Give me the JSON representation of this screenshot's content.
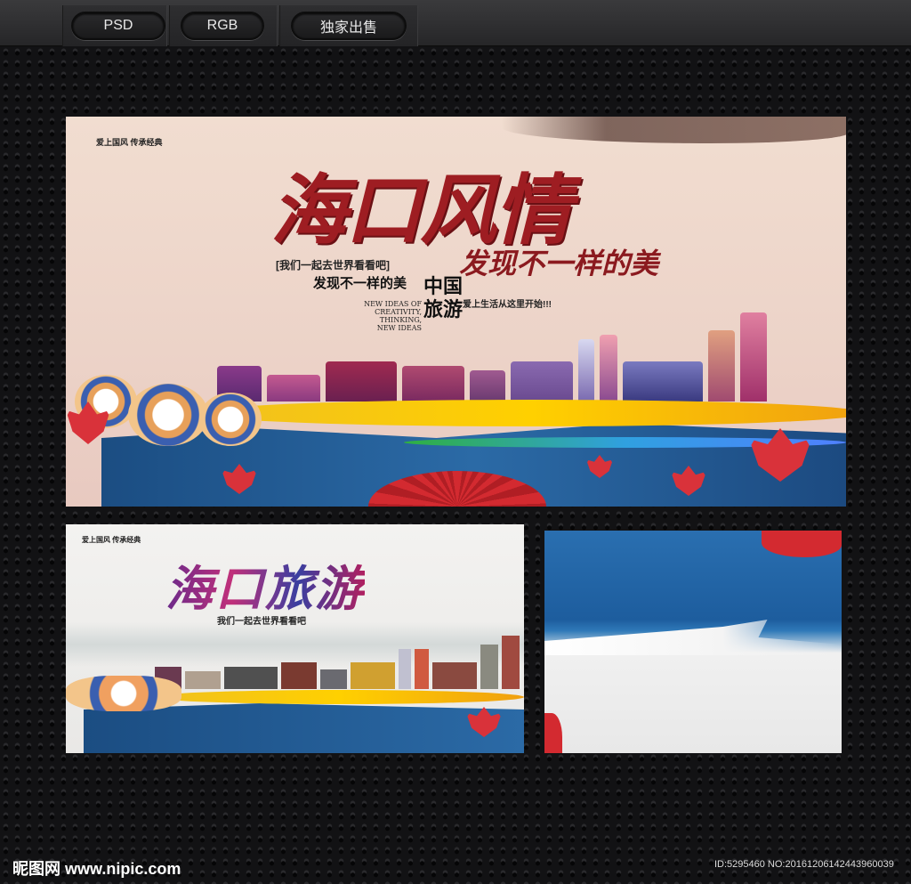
{
  "toolbar": {
    "buttons": [
      {
        "label": "PSD"
      },
      {
        "label": "RGB"
      },
      {
        "label": "独家出售"
      }
    ]
  },
  "poster_main": {
    "tagline_top": "爱上国风 传承经典",
    "title": "海口风情",
    "subtitle": "发现不一样的美",
    "bracket_text": "[我们一起去世界看看吧]",
    "discover": "发现不一样的美",
    "china_travel": "中国旅游",
    "english": "NEW IDEAS OF CREATIVITY, THINKING, NEW IDEAS",
    "love_life": "爱上生活从这里开始!!!"
  },
  "poster_second": {
    "tagline_top": "爱上国风 传承经典",
    "title": "海口旅游",
    "subtitle": "我们一起去世界看看吧"
  },
  "footer": {
    "logo": "昵图网 www.nipic.com",
    "id_text": "ID:5295460 NO:20161206142443960039"
  }
}
